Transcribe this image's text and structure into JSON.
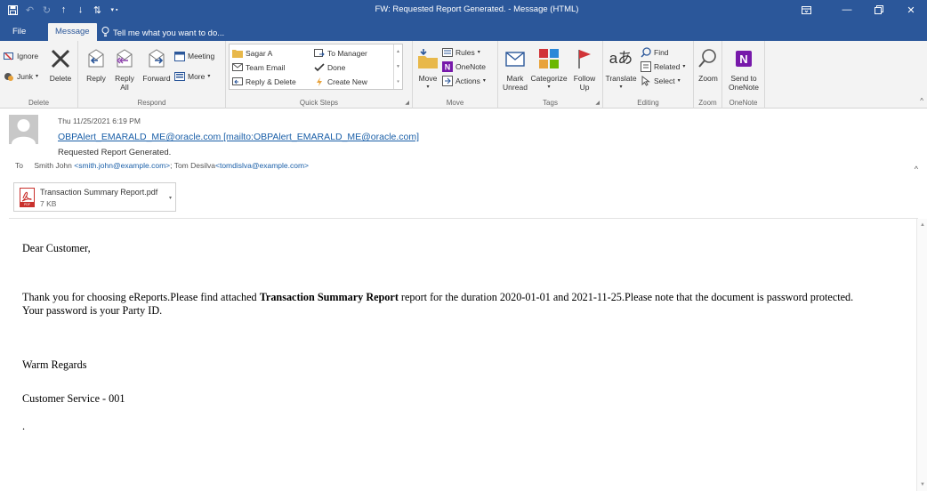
{
  "window": {
    "title": "FW: Requested Report Generated. - Message (HTML)",
    "controls": [
      "restore-ribbon",
      "minimize",
      "maximize",
      "close"
    ]
  },
  "tabs": {
    "file": "File",
    "message": "Message",
    "tell_me": "Tell me what you want to do..."
  },
  "ribbon": {
    "delete_group": {
      "label": "Delete",
      "ignore": "Ignore",
      "junk": "Junk",
      "delete": "Delete"
    },
    "respond_group": {
      "label": "Respond",
      "reply": "Reply",
      "reply_all_1": "Reply",
      "reply_all_2": "All",
      "forward": "Forward",
      "meeting": "Meeting",
      "more": "More"
    },
    "quick_steps": {
      "label": "Quick Steps",
      "items": [
        "Sagar A",
        "To Manager",
        "Team Email",
        "Done",
        "Reply & Delete",
        "Create New"
      ]
    },
    "move_group": {
      "label": "Move",
      "move": "Move",
      "rules": "Rules",
      "onenote": "OneNote",
      "actions": "Actions"
    },
    "tags_group": {
      "label": "Tags",
      "mark_unread_1": "Mark",
      "mark_unread_2": "Unread",
      "categorize": "Categorize",
      "follow_up_1": "Follow",
      "follow_up_2": "Up"
    },
    "editing_group": {
      "label": "Editing",
      "translate": "Translate",
      "find": "Find",
      "related": "Related",
      "select": "Select"
    },
    "zoom_group": {
      "label": "Zoom",
      "zoom": "Zoom"
    },
    "onenote_group": {
      "label": "OneNote",
      "send_to_1": "Send to",
      "send_to_2": "OneNote"
    }
  },
  "message": {
    "date": "Thu 11/25/2021 6:19 PM",
    "from_email": "OBPAlert_EMARALD_ME@oracle.com",
    "from_mailto": "[mailto:OBPAlert_EMARALD_ME@oracle.com]",
    "subject": "Requested Report Generated.",
    "to_label": "To",
    "to_name_1": "Smith John",
    "to_addr_1": "<smith.john@example.com>",
    "to_sep": ";",
    "to_name_2": "Tom Desilva",
    "to_addr_2": "<tomdislva@example.com>"
  },
  "attachment": {
    "name": "Transaction Summary Report.pdf",
    "size": "7 KB",
    "type_label": "PDF"
  },
  "body": {
    "greeting": "Dear Customer,",
    "para_pre": "Thank you for choosing eReports.Please find attached ",
    "para_bold": "Transaction Summary Report",
    "para_post": " report for the duration 2020-01-01 and 2021-11-25.Please note that the document is password protected.",
    "para_line2": "Your password is your Party ID.",
    "regards": "Warm Regards",
    "signature": "Customer Service - 001",
    "trailing": "."
  },
  "colors": {
    "titlebar": "#2b579a",
    "ribbon_bg": "#f3f3f3",
    "link": "#1a5fa8",
    "pdf_red": "#c9302c"
  }
}
